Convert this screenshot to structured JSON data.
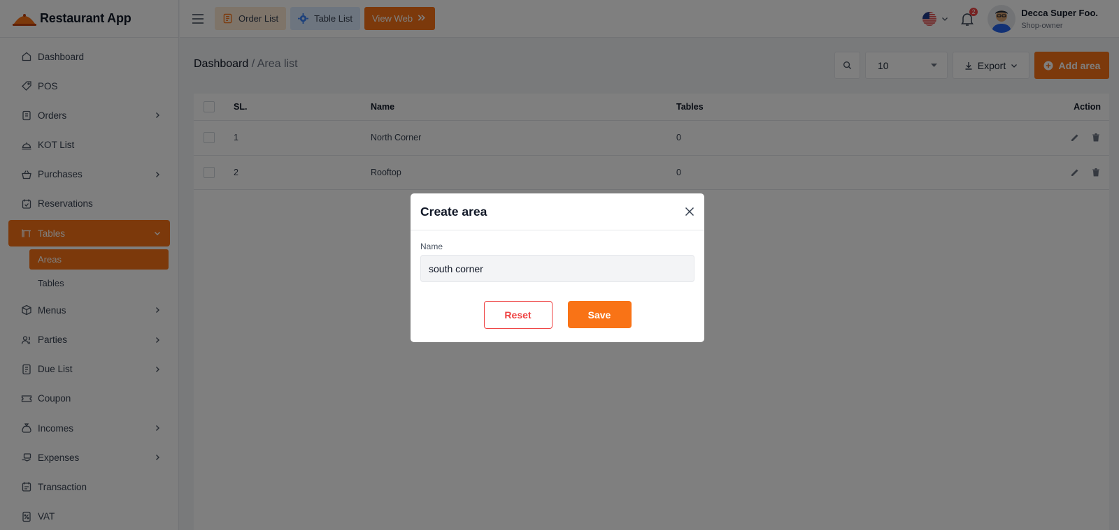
{
  "app": {
    "name": "Restaurant App",
    "logo_icon": "restaurant-logo-icon"
  },
  "header": {
    "menu_icon": "hamburger-icon",
    "buttons": [
      {
        "label": "Order List",
        "icon": "order-list-icon"
      },
      {
        "label": "Table List",
        "icon": "gear-icon"
      },
      {
        "label": "View Web",
        "icon": "double-chevron-right-icon"
      }
    ],
    "language_flag": "us-flag-icon",
    "notification_count": "2",
    "user": {
      "name": "Decca Super Foo.",
      "role": "Shop-owner"
    }
  },
  "sidebar": {
    "items": [
      {
        "label": "Dashboard",
        "icon": "home-icon",
        "has_children": false
      },
      {
        "label": "POS",
        "icon": "tag-icon",
        "has_children": false
      },
      {
        "label": "Orders",
        "icon": "clipboard-icon",
        "has_children": true
      },
      {
        "label": "KOT List",
        "icon": "cloche-icon",
        "has_children": false
      },
      {
        "label": "Purchases",
        "icon": "basket-icon",
        "has_children": true
      },
      {
        "label": "Reservations",
        "icon": "calendar-check-icon",
        "has_children": false
      },
      {
        "label": "Tables",
        "icon": "table-icon",
        "has_children": true,
        "active": true,
        "expanded": true,
        "children": [
          {
            "label": "Areas",
            "active": true
          },
          {
            "label": "Tables",
            "active": false
          }
        ]
      },
      {
        "label": "Menus",
        "icon": "box-icon",
        "has_children": true
      },
      {
        "label": "Parties",
        "icon": "users-icon",
        "has_children": true
      },
      {
        "label": "Due List",
        "icon": "receipt-icon",
        "has_children": true
      },
      {
        "label": "Coupon",
        "icon": "ticket-icon",
        "has_children": false
      },
      {
        "label": "Incomes",
        "icon": "money-bag-icon",
        "has_children": true
      },
      {
        "label": "Expenses",
        "icon": "hand-cash-icon",
        "has_children": true
      },
      {
        "label": "Transaction",
        "icon": "calendar-list-icon",
        "has_children": false
      },
      {
        "label": "VAT",
        "icon": "percent-doc-icon",
        "has_children": false
      }
    ]
  },
  "breadcrumb": {
    "root": "Dashboard",
    "separator": "/",
    "current": "Area list"
  },
  "toolbar": {
    "per_page": "10",
    "export_label": "Export",
    "add_label": "Add area"
  },
  "table": {
    "columns": [
      "SL.",
      "Name",
      "Tables",
      "Action"
    ],
    "rows": [
      {
        "sl": "1",
        "name": "North Corner",
        "tables": "0"
      },
      {
        "sl": "2",
        "name": "Rooftop",
        "tables": "0"
      }
    ]
  },
  "modal": {
    "title": "Create area",
    "field_label": "Name",
    "field_value": "south corner",
    "reset_label": "Reset",
    "save_label": "Save"
  },
  "colors": {
    "accent": "#f97316",
    "danger": "#ef4444",
    "overlay": "rgba(0,0,0,0.5)"
  }
}
